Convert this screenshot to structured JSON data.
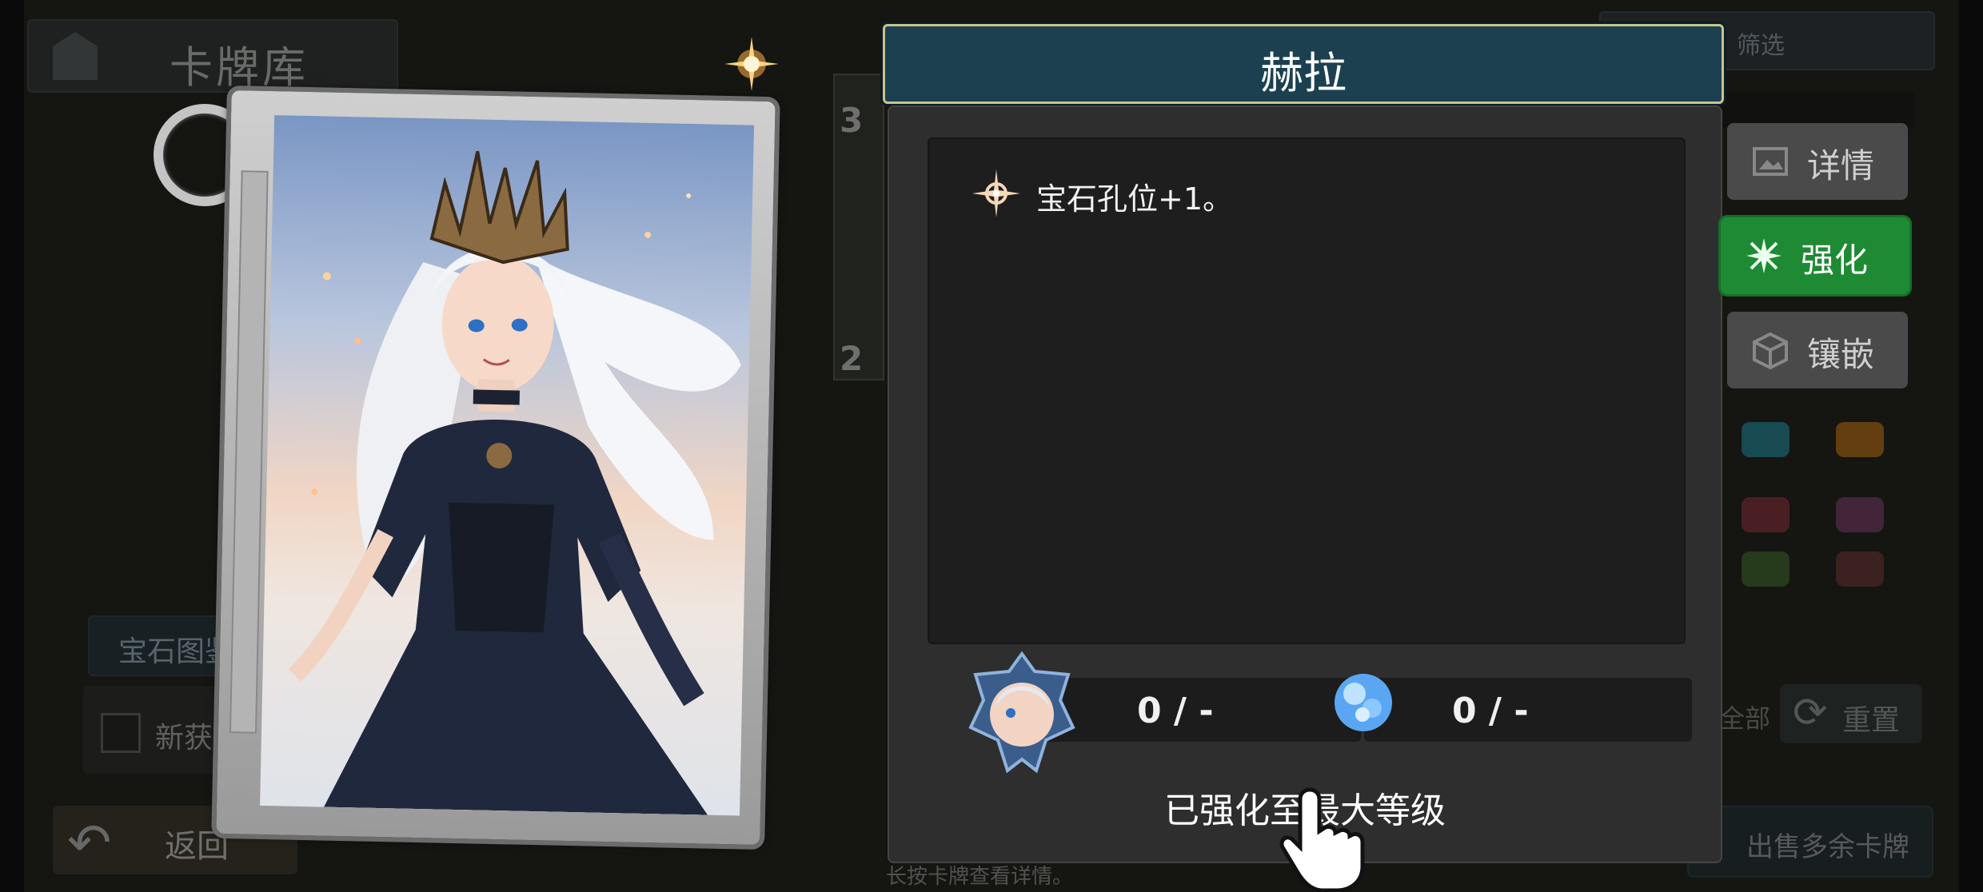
{
  "background": {
    "library_title": "卡牌库",
    "gem_book_label": "宝石图鉴",
    "new_get_label": "新获得",
    "back_label": "返回",
    "filter_label": "筛选",
    "small_card_count_top": "3",
    "small_card_count_bottom": "2",
    "all_label": "全部",
    "reset_label": "重置",
    "sell_label": "出售多余卡牌",
    "hint_text": "长按卡牌查看详情。"
  },
  "card": {
    "name": "赫拉"
  },
  "enhance_panel": {
    "title": "赫拉",
    "description": "宝石孔位+1。",
    "cost_card_value": "0 / -",
    "cost_crystal_value": "0 / -",
    "status_text": "已强化至最大等级"
  },
  "side_tabs": {
    "detail": "详情",
    "enhance": "强化",
    "inlay": "镶嵌",
    "active": "enhance"
  },
  "colors": {
    "accent_green": "#1f8a34",
    "title_bar": "#1c4050",
    "title_border": "#c9c38c"
  }
}
